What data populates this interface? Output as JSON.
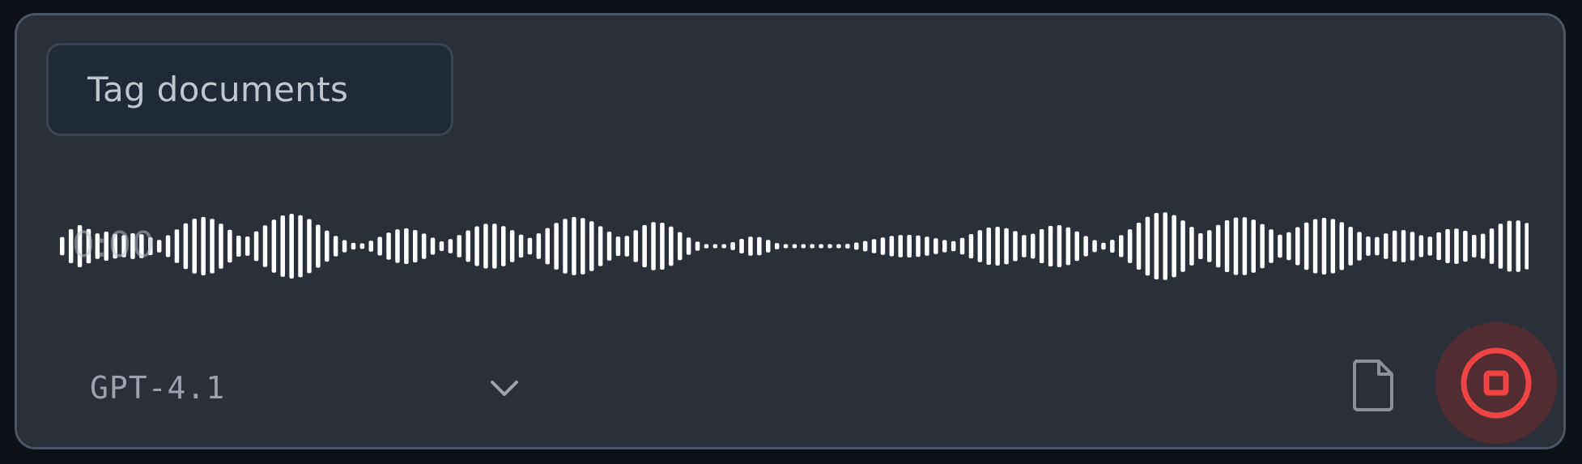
{
  "recorder": {
    "tag_label": "Tag documents",
    "timer": "0:00",
    "model": "GPT-4.1",
    "icons": {
      "dropdown": "chevron-down-icon",
      "attach": "file-icon",
      "stop": "stop-record-icon"
    },
    "colors": {
      "panel_bg": "#2b2f37",
      "chip_bg": "#1f2937",
      "wave": "#ffffff",
      "stop_accent": "#ef4444"
    }
  }
}
